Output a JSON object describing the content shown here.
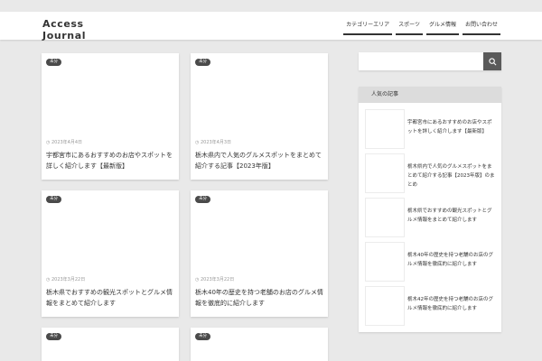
{
  "header": {
    "site_title": "Access Journal",
    "nav": [
      "カテゴリーエリア",
      "スポーツ",
      "グルメ情報",
      "お問い合わせ"
    ]
  },
  "cards": [
    {
      "badge": "未分",
      "date": "◷ 2023年4月4日",
      "title": "宇都宮市にあるおすすめのお店やスポットを詳しく紹介します【最新版】"
    },
    {
      "badge": "未分",
      "date": "◷ 2023年4月3日",
      "title": "栃木県内で人気のグルメスポットをまとめて紹介する記事【2023年版】"
    },
    {
      "badge": "未分",
      "date": "◷ 2023年3月22日",
      "title": "栃木県でおすすめの観光スポットとグルメ情報をまとめて紹介します"
    },
    {
      "badge": "未分",
      "date": "◷ 2023年3月22日",
      "title": "栃木40年の歴史を持つ老舗のお店のグルメ情報を徹底的に紹介します"
    },
    {
      "badge": "未分",
      "date": "",
      "title": ""
    },
    {
      "badge": "未分",
      "date": "",
      "title": ""
    }
  ],
  "search": {
    "placeholder": "",
    "button_icon": "search-icon"
  },
  "sidebar": {
    "widget_title": "人気の記事",
    "items": [
      {
        "title": "宇都宮市にあるおすすめのお店やスポットを詳しく紹介します【最新版】"
      },
      {
        "title": "栃木県内で人気のグルメスポットをまとめて紹介する記事【2023年版】のまとめ"
      },
      {
        "title": "栃木県でおすすめの観光スポットとグルメ情報をまとめて紹介します"
      },
      {
        "title": "栃木40年の歴史を持つ老舗のお店のグルメ情報を徹底的に紹介します"
      },
      {
        "title": "栃木42年の歴史を持つ老舗のお店のグルメ情報を徹底的に紹介します"
      }
    ]
  }
}
